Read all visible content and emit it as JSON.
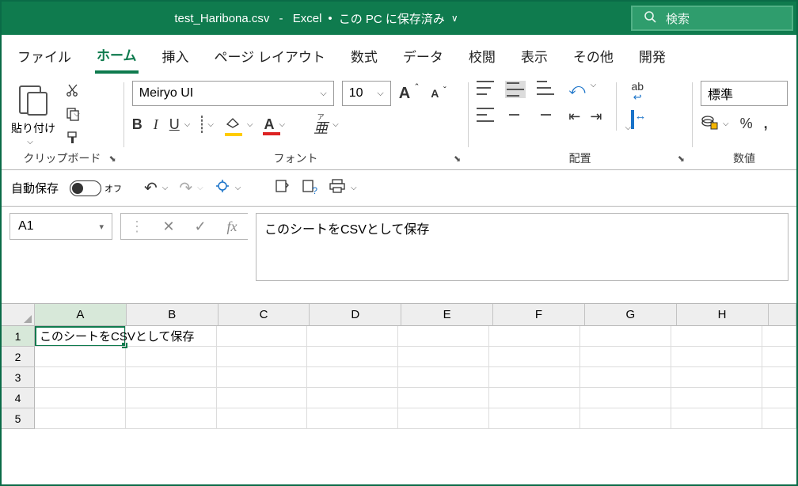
{
  "title": {
    "filename": "test_Haribona.csv",
    "appname": "Excel",
    "saved_msg": "この PC に保存済み"
  },
  "search": {
    "placeholder": "検索"
  },
  "tabs": {
    "file": "ファイル",
    "home": "ホーム",
    "insert": "挿入",
    "pagelayout": "ページ レイアウト",
    "formulas": "数式",
    "data": "データ",
    "review": "校閲",
    "view": "表示",
    "other": "その他",
    "developer": "開発"
  },
  "ribbon": {
    "clipboard": {
      "paste": "貼り付け",
      "group_label": "クリップボード"
    },
    "font": {
      "name": "Meiryo UI",
      "size": "10",
      "group_label": "フォント"
    },
    "alignment": {
      "group_label": "配置"
    },
    "number": {
      "format": "標準",
      "group_label": "数値"
    }
  },
  "qat": {
    "autosave_label": "自動保存",
    "autosave_state": "オフ"
  },
  "namebox": {
    "ref": "A1"
  },
  "formulabar": {
    "value": "このシートをCSVとして保存"
  },
  "grid": {
    "columns": [
      "A",
      "B",
      "C",
      "D",
      "E",
      "F",
      "G",
      "H"
    ],
    "rows": [
      "1",
      "2",
      "3",
      "4",
      "5"
    ],
    "a1": "このシートをCSVとして保存"
  }
}
